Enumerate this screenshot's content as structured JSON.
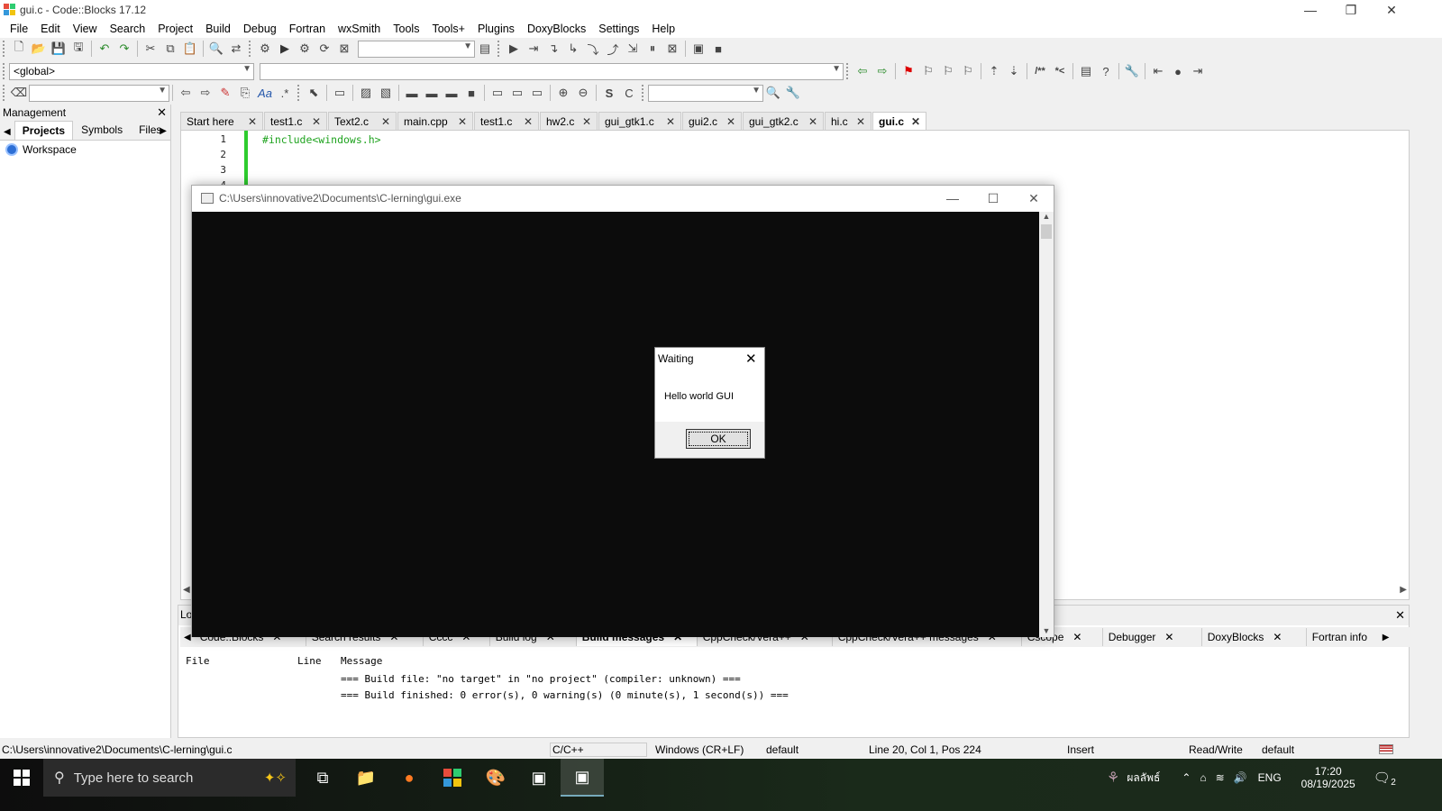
{
  "window": {
    "title": "gui.c - Code::Blocks 17.12",
    "minimize": "—",
    "maximize": "❐",
    "close": "✕"
  },
  "menu": [
    "File",
    "Edit",
    "View",
    "Search",
    "Project",
    "Build",
    "Debug",
    "Fortran",
    "wxSmith",
    "Tools",
    "Tools+",
    "Plugins",
    "DoxyBlocks",
    "Settings",
    "Help"
  ],
  "toolbar": {
    "scope_combo": "<global>",
    "search_combo": ""
  },
  "management": {
    "title": "Management",
    "tabs": [
      "Projects",
      "Symbols",
      "Files"
    ],
    "active_tab": "Projects",
    "tree": [
      "Workspace"
    ]
  },
  "editor_tabs": [
    {
      "label": "Start here",
      "active": false
    },
    {
      "label": "test1.c",
      "active": false
    },
    {
      "label": "Text2.c",
      "active": false
    },
    {
      "label": "main.cpp",
      "active": false
    },
    {
      "label": "test1.c",
      "active": false
    },
    {
      "label": "hw2.c",
      "active": false
    },
    {
      "label": "gui_gtk1.c",
      "active": false
    },
    {
      "label": "gui2.c",
      "active": false
    },
    {
      "label": "gui_gtk2.c",
      "active": false
    },
    {
      "label": "hi.c",
      "active": false
    },
    {
      "label": "gui.c",
      "active": true
    }
  ],
  "editor": {
    "line_numbers": [
      "1",
      "2",
      "3",
      "4"
    ],
    "code_line_1": "#include<windows.h>"
  },
  "console": {
    "title": "C:\\Users\\innovative2\\Documents\\C-lerning\\gui.exe"
  },
  "dialog": {
    "title": "Waiting",
    "message": "Hello world GUI",
    "ok_label": "OK"
  },
  "logs": {
    "header_label": "Lo",
    "tabs": [
      "Code::Blocks",
      "Search results",
      "Cccc",
      "Build log",
      "Build messages",
      "CppCheck/Vera++",
      "CppCheck/Vera++ messages",
      "Cscope",
      "Debugger",
      "DoxyBlocks",
      "Fortran info"
    ],
    "active_tab": "Build messages",
    "columns": [
      "File",
      "Line",
      "Message"
    ],
    "rows": [
      "=== Build file: \"no target\" in \"no project\" (compiler: unknown) ===",
      "=== Build finished: 0 error(s), 0 warning(s) (0 minute(s), 1 second(s)) ==="
    ]
  },
  "status": {
    "path": "C:\\Users\\innovative2\\Documents\\C-lerning\\gui.c",
    "language": "C/C++",
    "eol": "Windows (CR+LF)",
    "encoding": "default",
    "position": "Line 20, Col 1, Pos 224",
    "mode": "Insert",
    "access": "Read/Write",
    "profile": "default"
  },
  "taskbar": {
    "search_placeholder": "Type here to search",
    "user_label": "ผลลัพธ์",
    "lang": "ENG",
    "time": "17:20",
    "date": "08/19/2025",
    "notifications": "2"
  },
  "colors": {
    "accent_green": "#2ecc2e",
    "code_green": "#1fa31f",
    "console_bg": "#0c0c0c"
  }
}
